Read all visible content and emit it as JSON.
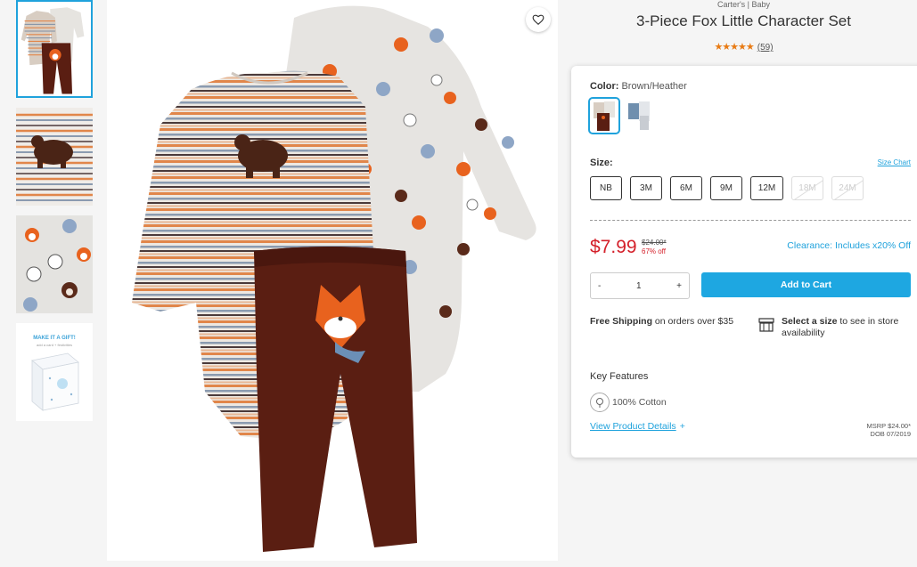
{
  "product": {
    "brand": "Carter's | Baby",
    "title": "3-Piece Fox Little Character Set",
    "stars": "★★★★★",
    "review_count": "(59)",
    "rating_value": 5
  },
  "color": {
    "label": "Color:",
    "value": "Brown/Heather",
    "swatches": [
      "Brown/Heather",
      "Blue"
    ]
  },
  "size": {
    "label": "Size:",
    "chart_link": "Size Chart",
    "options": [
      {
        "label": "NB",
        "available": true
      },
      {
        "label": "3M",
        "available": true
      },
      {
        "label": "6M",
        "available": true
      },
      {
        "label": "9M",
        "available": true
      },
      {
        "label": "12M",
        "available": true
      },
      {
        "label": "18M",
        "available": false
      },
      {
        "label": "24M",
        "available": false
      }
    ]
  },
  "price": {
    "current": "$7.99",
    "original": "$24.00*",
    "discount": "67% off",
    "clearance": "Clearance: Includes x20% Off"
  },
  "quantity": {
    "minus": "-",
    "value": "1",
    "plus": "+"
  },
  "cart_button": "Add to Cart",
  "shipping": {
    "bold": "Free Shipping",
    "rest": " on orders over $35"
  },
  "store": {
    "bold": "Select a size",
    "rest": " to see in store availability"
  },
  "key_features": {
    "title": "Key Features",
    "items": [
      "100% Cotton"
    ]
  },
  "details_link": "View Product Details",
  "details_plus": "+",
  "msrp": {
    "line1": "MSRP $24.00*",
    "line2": "DOB 07/2019"
  },
  "gift": {
    "title": "MAKE IT A GIFT!",
    "sub": "add a card + festivities"
  },
  "colors": {
    "accent": "#1fa2dc",
    "cart": "#1ea7e1",
    "price": "#d4202a",
    "stars": "#e87b14"
  }
}
